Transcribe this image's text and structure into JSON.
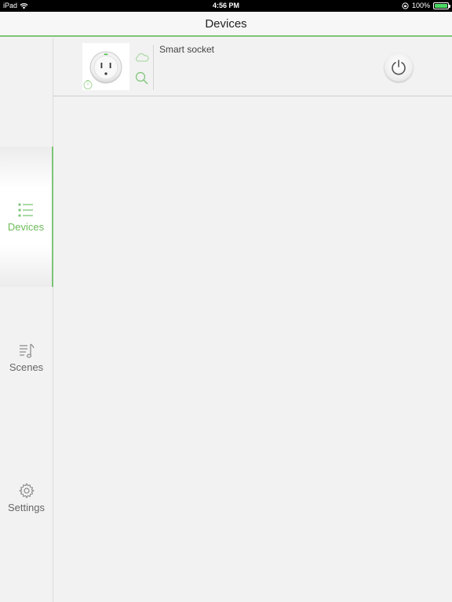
{
  "status_bar": {
    "carrier": "iPad",
    "time": "4:56 PM",
    "battery_percent": "100%",
    "battery_level": 1.0
  },
  "nav": {
    "title": "Devices"
  },
  "sidebar": {
    "tabs": [
      {
        "label": "Devices",
        "icon": "list-icon",
        "active": true
      },
      {
        "label": "Scenes",
        "icon": "music-list-icon",
        "active": false
      },
      {
        "label": "Settings",
        "icon": "gear-icon",
        "active": false
      }
    ]
  },
  "devices": [
    {
      "name": "Smart socket",
      "icons": [
        "cloud-icon",
        "search-icon",
        "timer-icon",
        "power-icon"
      ]
    }
  ],
  "colors": {
    "accent": "#7cc576",
    "active_label": "#6cbb5a",
    "background": "#f2f2f2"
  }
}
